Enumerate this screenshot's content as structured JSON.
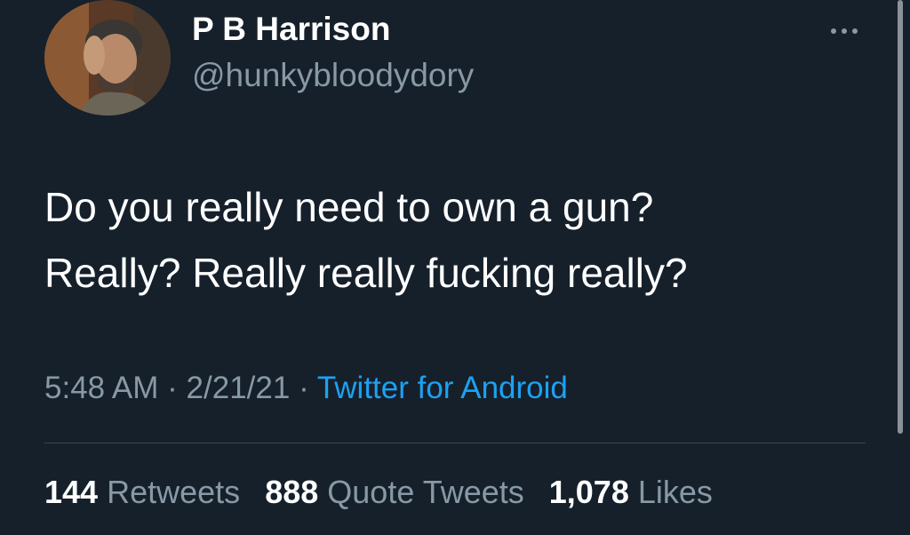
{
  "user": {
    "display_name": "P B Harrison",
    "handle": "@hunkybloodydory",
    "avatar_icon": "profile-photo"
  },
  "tweet": {
    "lines": [
      "Do you really need to own a gun?",
      "Really? Really really fucking really?"
    ]
  },
  "meta": {
    "time": "5:48 AM",
    "separator": "·",
    "date": "2/21/21",
    "source": "Twitter for Android"
  },
  "stats": {
    "retweets_count": "144",
    "retweets_label": "Retweets",
    "quotes_count": "888",
    "quotes_label": "Quote Tweets",
    "likes_count": "1,078",
    "likes_label": "Likes"
  },
  "colors": {
    "background": "#15202b",
    "secondary_text": "#8899a6",
    "link": "#1da1f2",
    "divider": "#38444d"
  },
  "icons": {
    "more": "more-horizontal-icon"
  }
}
